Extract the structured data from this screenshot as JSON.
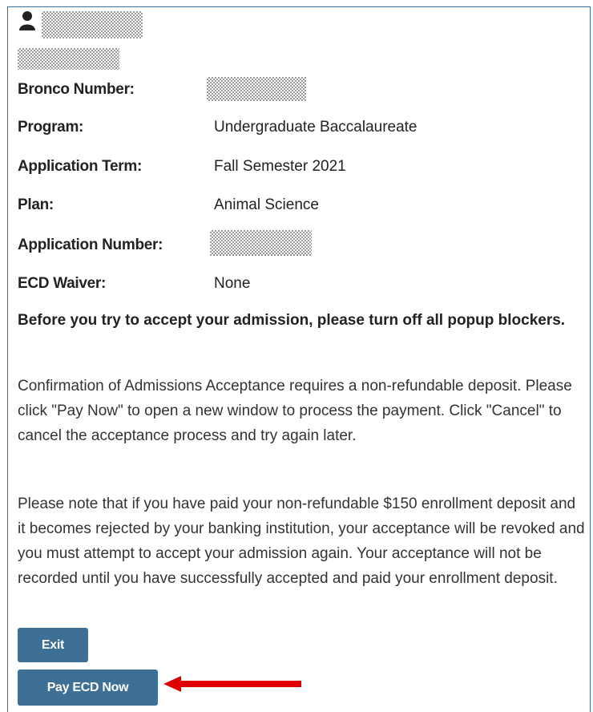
{
  "applicant": {
    "name_redacted": "",
    "id_redacted": ""
  },
  "details": [
    {
      "label": "Bronco Number:",
      "value": ""
    },
    {
      "label": "Program:",
      "value": "Undergraduate Baccalaureate"
    },
    {
      "label": "Application Term:",
      "value": "Fall Semester 2021"
    },
    {
      "label": "Plan:",
      "value": "Animal Science"
    },
    {
      "label": "Application Number:",
      "value": ""
    },
    {
      "label": "ECD Waiver:",
      "value": "None"
    }
  ],
  "notice_bold": "Before you try to accept your admission, please turn off all popup blockers.",
  "paragraphs": [
    "Confirmation of Admissions Acceptance requires a non-refundable deposit. Please click \"Pay Now\" to open a new window to process the payment. Click \"Cancel\" to cancel the acceptance process and try again later.",
    "Please note that if you have paid your non-refundable $150 enrollment deposit and it becomes rejected by your banking institution, your acceptance will be revoked and you must attempt to accept your admission again. Your acceptance will not be recorded until you have successfully accepted and paid your enrollment deposit."
  ],
  "buttons": {
    "exit": "Exit",
    "pay": "Pay ECD Now"
  },
  "colors": {
    "button_bg": "#3e6f94",
    "arrow": "#e00000",
    "border": "#3a6ea5"
  },
  "icons": {
    "user": "user-icon",
    "annotation": "red-arrow-icon"
  }
}
